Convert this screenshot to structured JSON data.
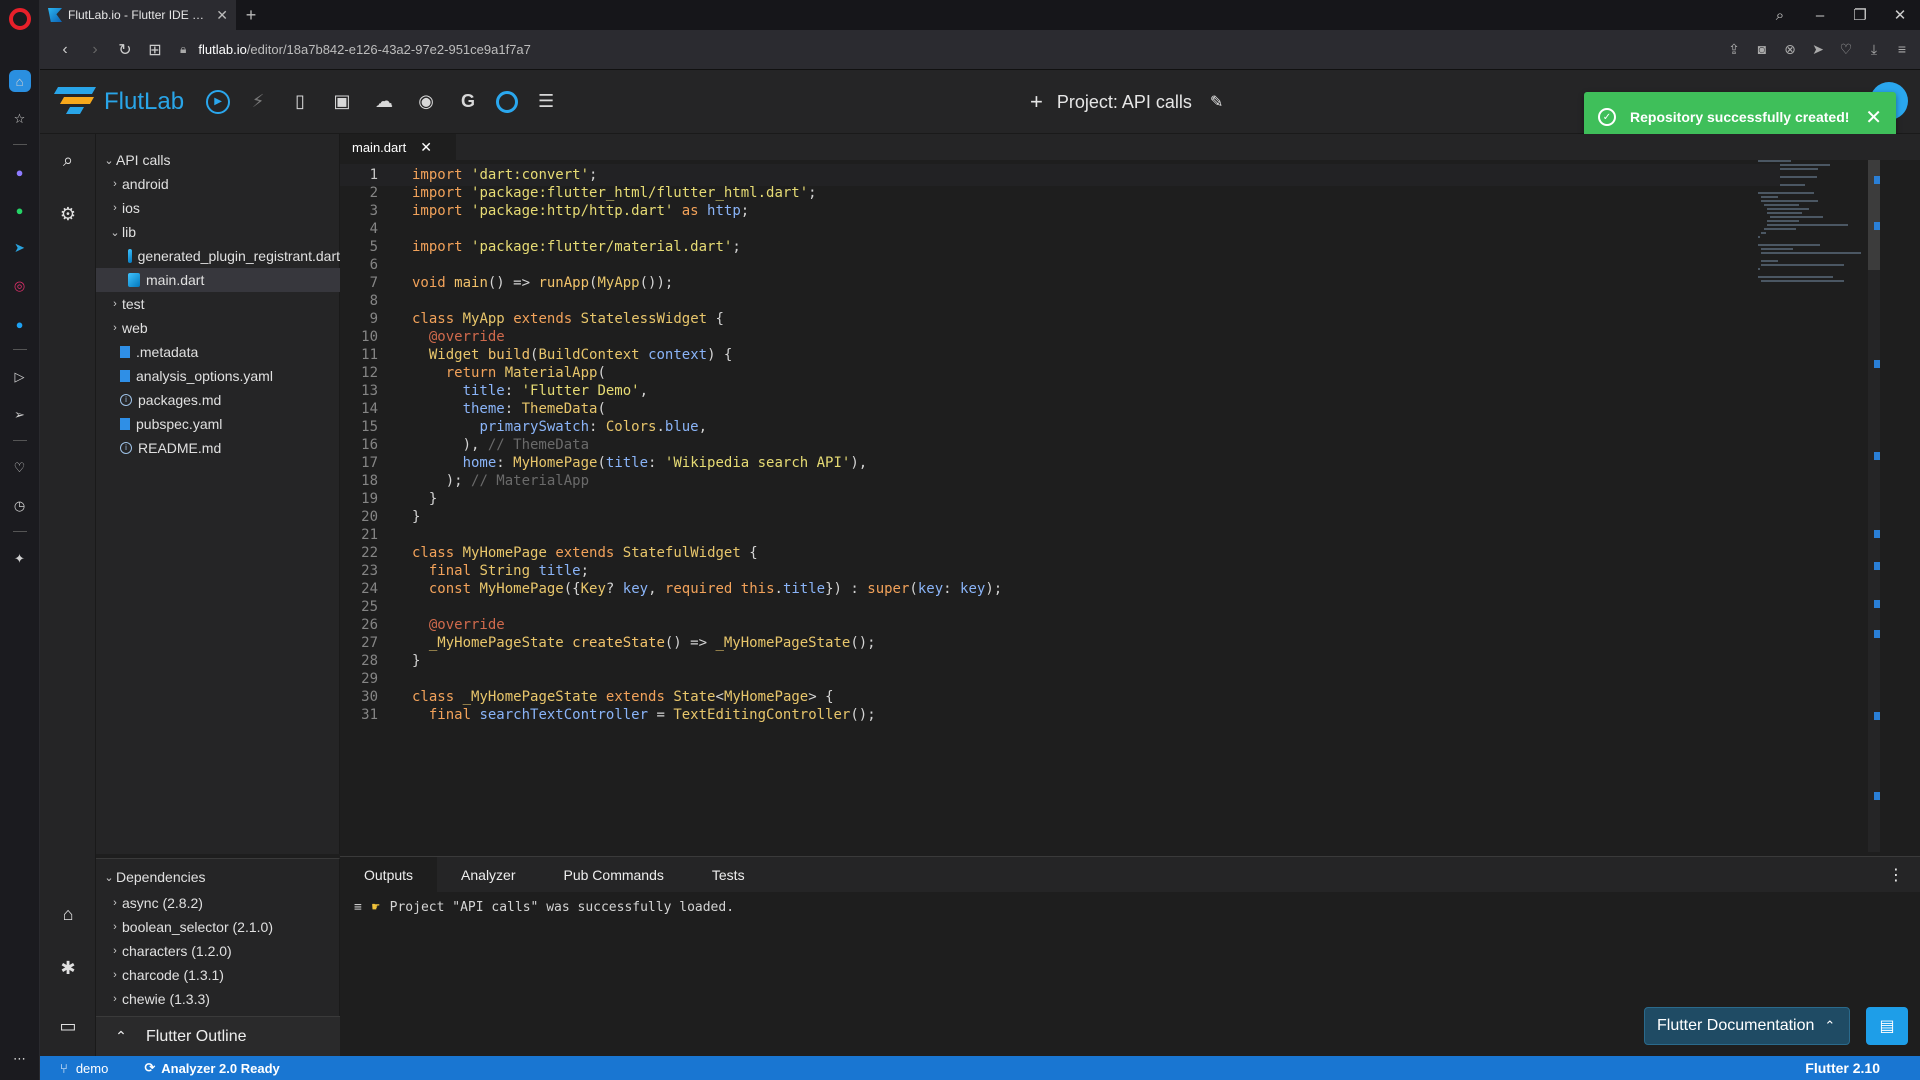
{
  "browser": {
    "tab_title": "FlutLab.io - Flutter IDE onli",
    "new_tab": "+",
    "url_host": "flutlab.io",
    "url_path": "/editor/18a7b842-e126-43a2-97e2-951ce9a1f7a7"
  },
  "app": {
    "logo_text": "FlutLab",
    "project_title": "Project: API calls"
  },
  "toast": {
    "message": "Repository successfully created!"
  },
  "tree": {
    "root": "API calls",
    "items": [
      {
        "label": "android",
        "kind": "folder",
        "depth": 1,
        "open": false
      },
      {
        "label": "ios",
        "kind": "folder",
        "depth": 1,
        "open": false
      },
      {
        "label": "lib",
        "kind": "folder",
        "depth": 1,
        "open": true
      },
      {
        "label": "generated_plugin_registrant.dart",
        "kind": "dart",
        "depth": 2
      },
      {
        "label": "main.dart",
        "kind": "dart",
        "depth": 2,
        "selected": true
      },
      {
        "label": "test",
        "kind": "folder",
        "depth": 1,
        "open": false
      },
      {
        "label": "web",
        "kind": "folder",
        "depth": 1,
        "open": false
      },
      {
        "label": ".metadata",
        "kind": "file",
        "depth": 1
      },
      {
        "label": "analysis_options.yaml",
        "kind": "file",
        "depth": 1
      },
      {
        "label": "packages.md",
        "kind": "info",
        "depth": 1
      },
      {
        "label": "pubspec.yaml",
        "kind": "file",
        "depth": 1
      },
      {
        "label": "README.md",
        "kind": "info",
        "depth": 1
      }
    ]
  },
  "deps": {
    "title": "Dependencies",
    "items": [
      "async (2.8.2)",
      "boolean_selector (2.1.0)",
      "characters (1.2.0)",
      "charcode (1.3.1)",
      "chewie (1.3.3)"
    ]
  },
  "outline": {
    "label": "Flutter Outline"
  },
  "editor": {
    "tab": "main.dart",
    "current_line": 1,
    "lines": [
      "import 'dart:convert';",
      "import 'package:flutter_html/flutter_html.dart';",
      "import 'package:http/http.dart' as http;",
      "",
      "import 'package:flutter/material.dart';",
      "",
      "void main() => runApp(MyApp());",
      "",
      "class MyApp extends StatelessWidget {",
      "  @override",
      "  Widget build(BuildContext context) {",
      "    return MaterialApp(",
      "      title: 'Flutter Demo',",
      "      theme: ThemeData(",
      "        primarySwatch: Colors.blue,",
      "      ), // ThemeData",
      "      home: MyHomePage(title: 'Wikipedia search API'),",
      "    ); // MaterialApp",
      "  }",
      "}",
      "",
      "class MyHomePage extends StatefulWidget {",
      "  final String title;",
      "  const MyHomePage({Key? key, required this.title}) : super(key: key);",
      "",
      "  @override",
      "  _MyHomePageState createState() => _MyHomePageState();",
      "}",
      "",
      "class _MyHomePageState extends State<MyHomePage> {",
      "  final searchTextController = TextEditingController();"
    ]
  },
  "panel": {
    "tabs": [
      "Outputs",
      "Analyzer",
      "Pub Commands",
      "Tests"
    ],
    "active_tab": "Outputs",
    "output": "Project \"API calls\" was successfully loaded."
  },
  "docs_button": "Flutter Documentation",
  "status": {
    "branch": "demo",
    "analyzer": "Analyzer 2.0 Ready",
    "version": "Flutter 2.10"
  },
  "colors": {
    "accent": "#29a5e8",
    "toast": "#3fbf5a",
    "status": "#1976d2"
  }
}
